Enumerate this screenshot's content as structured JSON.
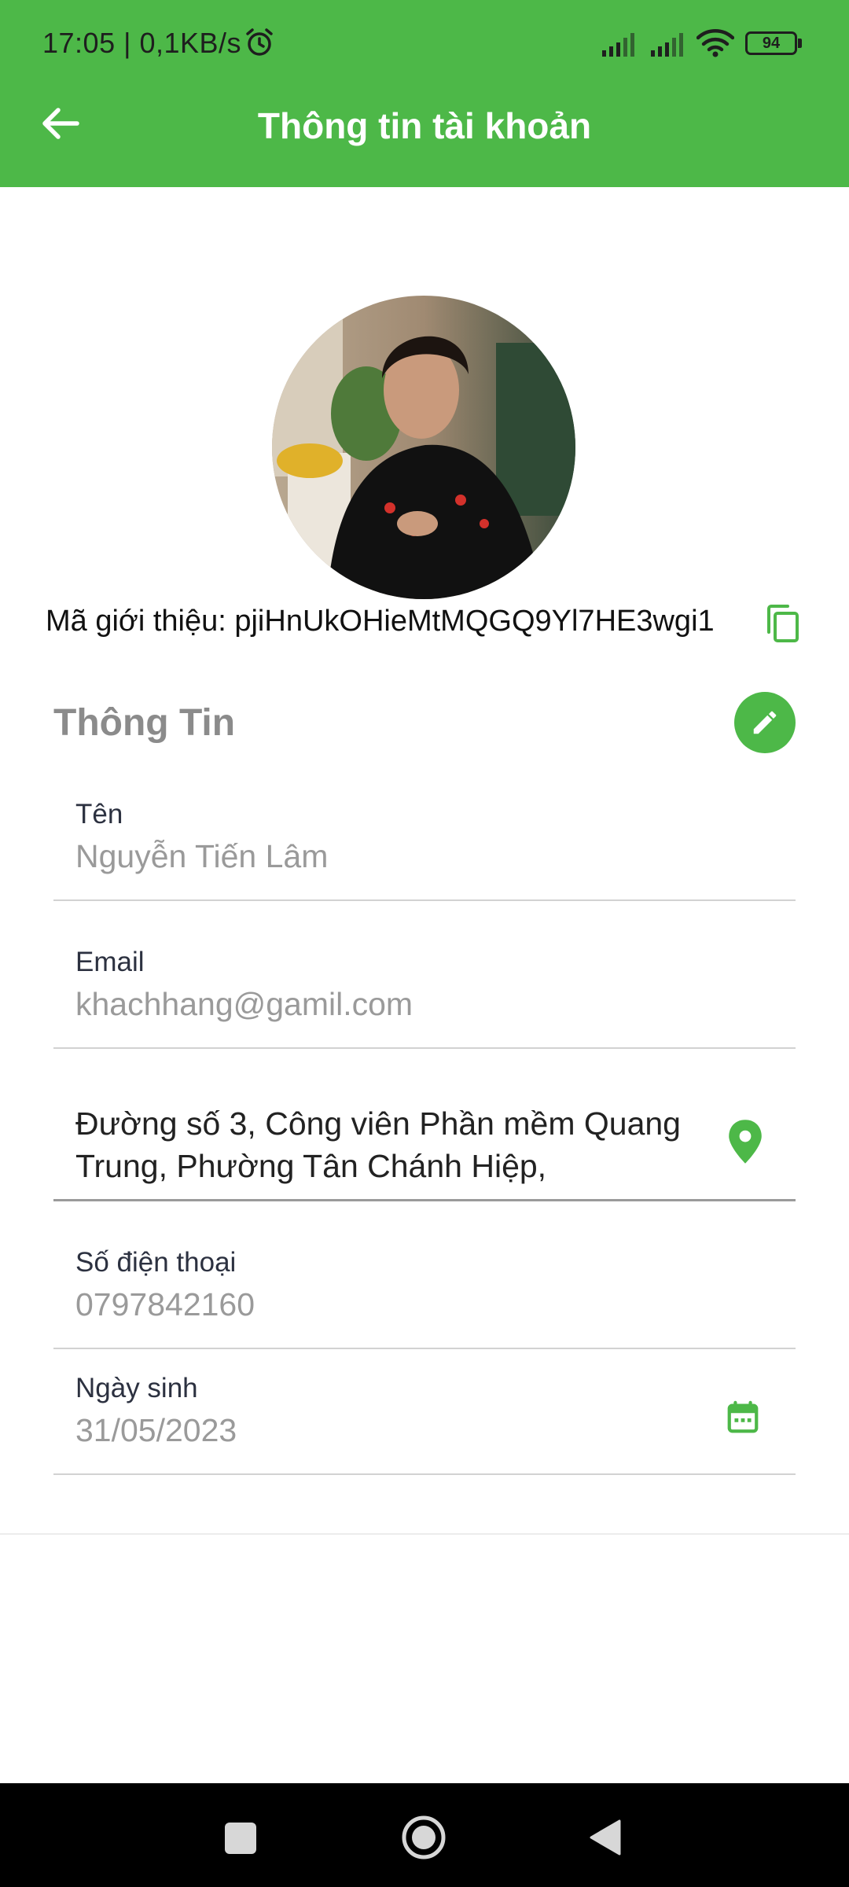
{
  "status_bar": {
    "time_speed": "17:05 | 0,1KB/s",
    "battery": "94",
    "icons": [
      "alarm-icon",
      "signal-icon",
      "signal-icon",
      "wifi-icon",
      "battery-icon"
    ]
  },
  "header": {
    "title": "Thông tin tài khoản",
    "back_icon": "arrow-left-icon"
  },
  "profile": {
    "referral_label": "Mã giới thiệu: ",
    "referral_code": "pjiHnUkOHieMtMQGQ9Yl7HE3wgi1"
  },
  "section": {
    "title": "Thông Tin"
  },
  "fields": {
    "name": {
      "label": "Tên",
      "value": "Nguyễn Tiến Lâm"
    },
    "email": {
      "label": "Email",
      "value": "khachhang@gamil.com"
    },
    "address": {
      "value": "Đường số 3, Công viên Phần mềm Quang Trung, Phường Tân Chánh Hiệp,"
    },
    "phone": {
      "label": "Số điện thoại",
      "value": "0797842160"
    },
    "birthday": {
      "label": "Ngày sinh",
      "value": "31/05/2023"
    }
  },
  "colors": {
    "primary": "#4db848",
    "section_title": "#8b8b8b",
    "value_text": "#9a9a9a"
  }
}
